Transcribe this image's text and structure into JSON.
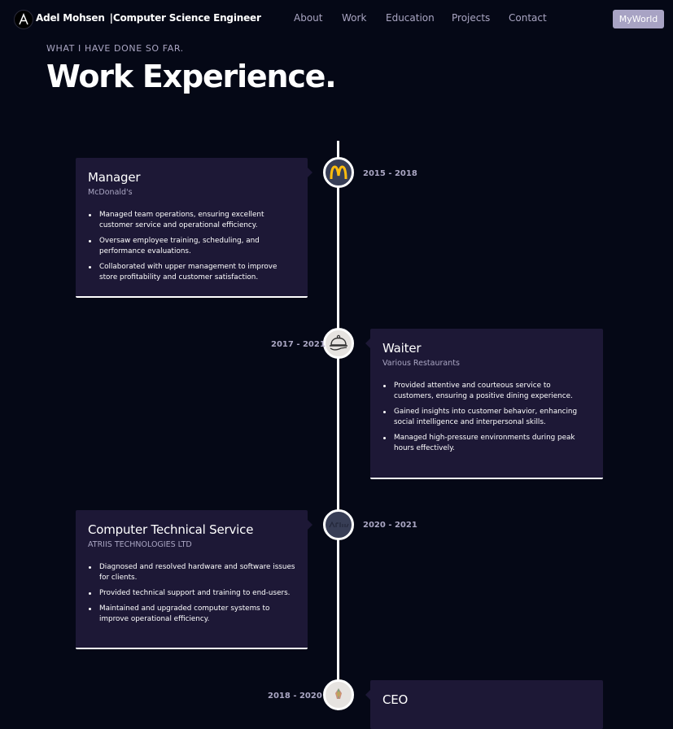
{
  "nav": {
    "brand_name": "Adel Mohsen",
    "brand_tagline": "|Computer Science Engineer",
    "links": [
      "About",
      "Work",
      "Education",
      "Projects",
      "Contact"
    ],
    "cta": "MyWorld"
  },
  "header": {
    "subtitle": "WHAT I HAVE DONE SO FAR.",
    "title": "Work Experience."
  },
  "experiences": [
    {
      "role": "Manager",
      "company": "McDonald's",
      "date": "2015 - 2018",
      "icon": "mcdonalds-logo-icon",
      "points": [
        "Managed team operations, ensuring excellent customer service and operational efficiency.",
        "Oversaw employee training, scheduling, and performance evaluations.",
        "Collaborated with upper management to improve store profitability and customer satisfaction."
      ]
    },
    {
      "role": "Waiter",
      "company": "Various Restaurants",
      "date": "2017 - 2021",
      "icon": "serving-cloche-icon",
      "points": [
        "Provided attentive and courteous service to customers, ensuring a positive dining experience.",
        "Gained insights into customer behavior, enhancing social intelligence and interpersonal skills.",
        "Managed high-pressure environments during peak hours effectively."
      ]
    },
    {
      "role": "Computer Technical Service",
      "company": "ATRIIS TECHNOLOGIES LTD",
      "date": "2020 - 2021",
      "icon": "atriis-logo-icon",
      "points": [
        "Diagnosed and resolved hardware and software issues for clients.",
        "Provided technical support and training to end-users.",
        "Maintained and upgraded computer systems to improve operational efficiency."
      ]
    },
    {
      "role": "CEO",
      "company": "",
      "date": "2018 - 2020",
      "icon": "crystal-logo-icon",
      "points": []
    }
  ],
  "colors": {
    "background": "#050816",
    "card": "#1d1836",
    "secondary_text": "#aaa6c3",
    "accent_button": "#a8a3c4"
  }
}
